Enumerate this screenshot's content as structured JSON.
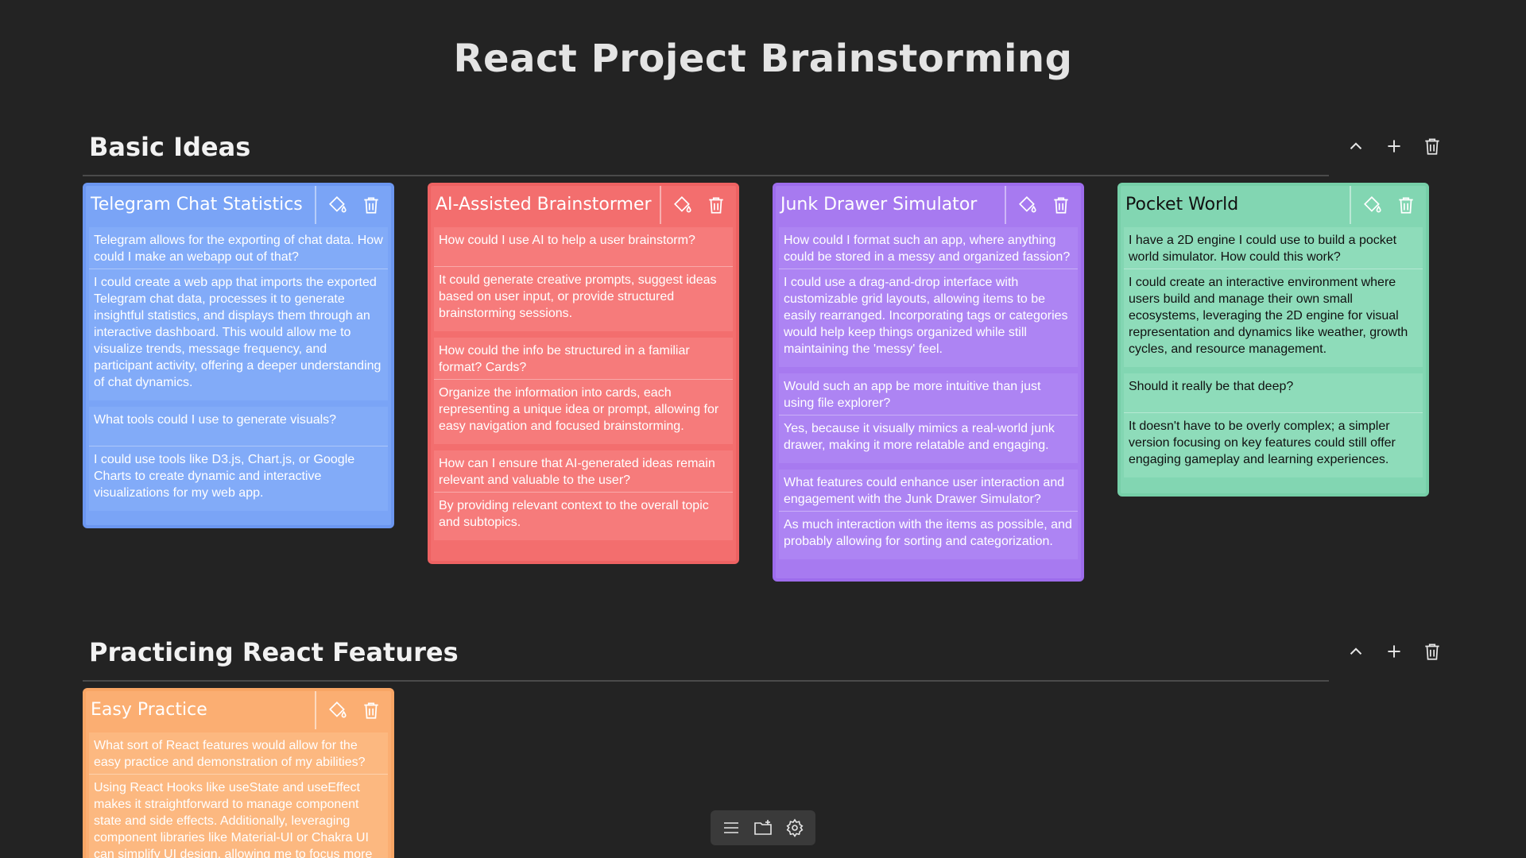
{
  "page": {
    "title": "React Project Brainstorming"
  },
  "colors": {
    "background": "#232323",
    "blue": "#7aa4f6",
    "red": "#f36e6e",
    "purple": "#a77af0",
    "green": "#82d6b2",
    "orange": "#fbae72"
  },
  "sections": [
    {
      "title": "Basic Ideas",
      "actions": [
        "chevron-up-icon",
        "plus-icon",
        "trash-icon"
      ],
      "cards": [
        {
          "title": "Telegram Chat Statistics",
          "color": "blue",
          "tools": [
            "paint-bucket-icon",
            "trash-icon"
          ],
          "items": [
            {
              "q": "Telegram allows for the exporting of chat data. How could I make an webapp out of that?",
              "a": "I could create a web app that imports the exported Telegram chat data, processes it to generate insightful statistics, and displays them through an interactive dashboard. This would allow me to visualize trends, message frequency, and participant activity, offering a deeper understanding of chat dynamics."
            },
            {
              "q": "What tools could I use to generate visuals?",
              "a": "I could use tools like D3.js, Chart.js, or Google Charts to create dynamic and interactive visualizations for my web app."
            }
          ]
        },
        {
          "title": "AI-Assisted Brainstormer",
          "color": "red",
          "tools": [
            "paint-bucket-icon",
            "trash-icon"
          ],
          "items": [
            {
              "q": "How could I use AI to help a user brainstorm?",
              "a": "It could generate creative prompts, suggest ideas based on user input, or provide structured brainstorming sessions."
            },
            {
              "q": "How could the info be structured in a familiar format? Cards?",
              "a": "Organize the information into cards, each representing a unique idea or prompt, allowing for easy navigation and focused brainstorming."
            },
            {
              "q": "How can I ensure that AI-generated ideas remain relevant and valuable to the user?",
              "a": "By providing relevant context to the overall topic and subtopics."
            }
          ]
        },
        {
          "title": "Junk Drawer Simulator",
          "color": "purple",
          "tools": [
            "paint-bucket-icon",
            "trash-icon"
          ],
          "items": [
            {
              "q": "How could I format such an app, where anything could be stored in a messy and organized fassion?",
              "a": "I could use a drag-and-drop interface with customizable grid layouts, allowing items to be easily rearranged. Incorporating tags or categories would help keep things organized while still maintaining the 'messy' feel."
            },
            {
              "q": "Would such an app be more intuitive than just using file explorer?",
              "a": "Yes, because it visually mimics a real-world junk drawer, making it more relatable and engaging."
            },
            {
              "q": "What features could enhance user interaction and engagement with the Junk Drawer Simulator?",
              "a": "As much interaction with the items as possible, and probably allowing for sorting and categorization."
            }
          ]
        },
        {
          "title": "Pocket World",
          "color": "green",
          "tools": [
            "paint-bucket-icon",
            "trash-icon"
          ],
          "items": [
            {
              "q": "I have a 2D engine I could use to build a pocket world simulator. How could this work?",
              "a": "I could create an interactive environment where users build and manage their own small ecosystems, leveraging the 2D engine for visual representation and dynamics like weather, growth cycles, and resource management."
            },
            {
              "q": "Should it really be that deep?",
              "a": "It doesn't have to be overly complex; a simpler version focusing on key features could still offer engaging gameplay and learning experiences."
            }
          ]
        }
      ]
    },
    {
      "title": "Practicing React Features",
      "actions": [
        "chevron-up-icon",
        "plus-icon",
        "trash-icon"
      ],
      "cards": [
        {
          "title": "Easy Practice",
          "color": "orange",
          "tools": [
            "paint-bucket-icon",
            "trash-icon"
          ],
          "items": [
            {
              "q": "What sort of React features would allow for the easy practice and demonstration of my abilities?",
              "a": "Using React Hooks like useState and useEffect makes it straightforward to manage component state and side effects. Additionally, leveraging component libraries like Material-UI or Chakra UI can simplify UI design, allowing me to focus more"
            }
          ]
        }
      ]
    }
  ],
  "toolbar": {
    "icons": [
      "menu-icon",
      "folder-add-icon",
      "settings-icon"
    ]
  }
}
